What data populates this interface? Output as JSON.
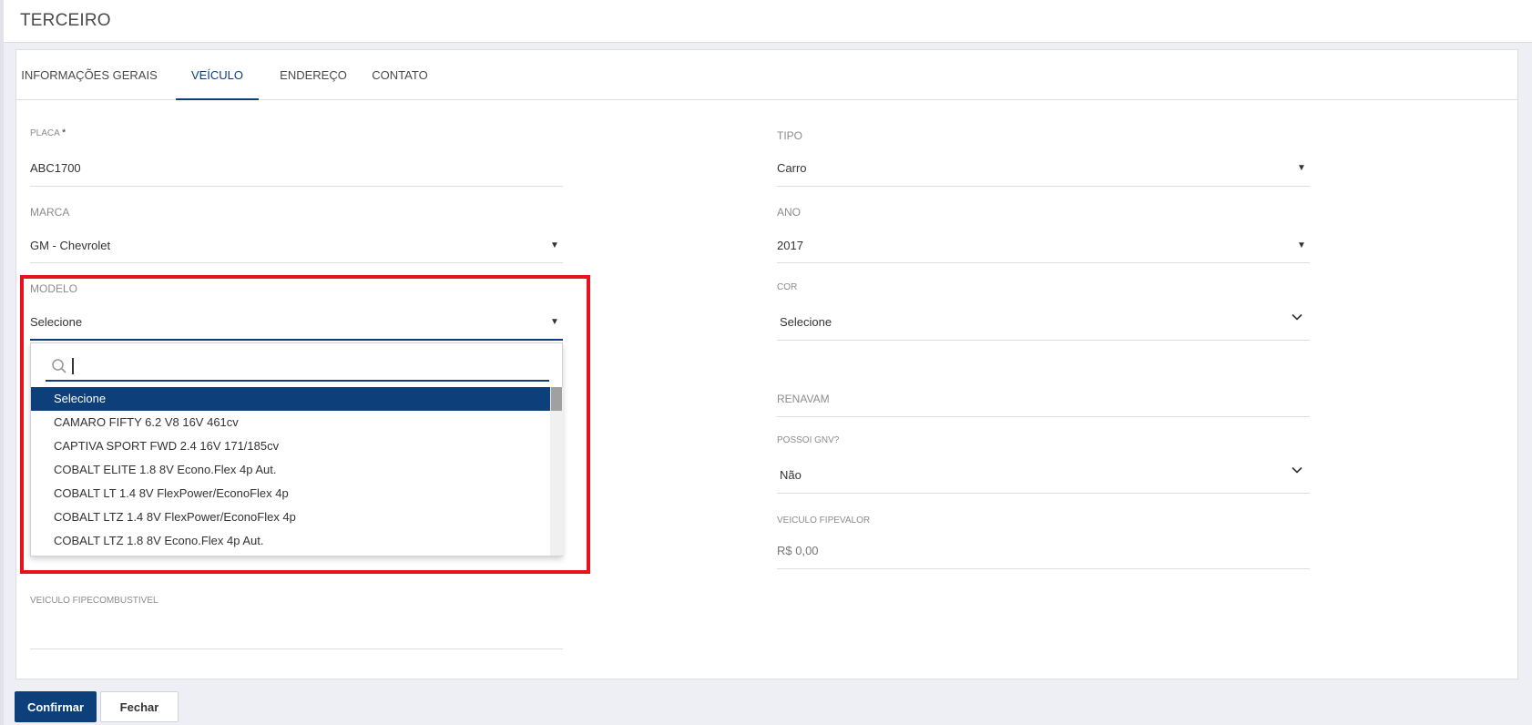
{
  "header": {
    "title": "TERCEIRO"
  },
  "tabs": [
    {
      "label": "INFORMAÇÕES GERAIS"
    },
    {
      "label": "VEÍCULO"
    },
    {
      "label": "ENDEREÇO"
    },
    {
      "label": "CONTATO"
    }
  ],
  "active_tab": "VEÍCULO",
  "fields": {
    "placa": {
      "label": "PLACA",
      "required_mark": "*",
      "value": "ABC1700"
    },
    "tipo": {
      "label": "TIPO",
      "value": "Carro"
    },
    "marca": {
      "label": "MARCA",
      "value": "GM - Chevrolet"
    },
    "ano": {
      "label": "ANO",
      "value": "2017"
    },
    "modelo": {
      "label": "MODELO",
      "value": "Selecione"
    },
    "cor": {
      "label": "COR",
      "value": "Selecione"
    },
    "renavam": {
      "label": "RENAVAM",
      "value": ""
    },
    "possui_gnv": {
      "label": "POSSOI GNV?",
      "value": "Não"
    },
    "fipe_valor": {
      "label": "VEICULO FIPEVALOR",
      "value": "R$ 0,00"
    },
    "fipe_combustivel": {
      "label": "VEICULO FIPECOMBUSTIVEL",
      "value": ""
    }
  },
  "modelo_dropdown": {
    "search_value": "",
    "options": [
      "Selecione",
      "CAMARO FIFTY 6.2 V8 16V 461cv",
      "CAPTIVA SPORT FWD 2.4 16V 171/185cv",
      "COBALT ELITE 1.8 8V Econo.Flex 4p Aut.",
      "COBALT LT 1.4 8V FlexPower/EconoFlex 4p",
      "COBALT LTZ 1.4 8V FlexPower/EconoFlex 4p",
      "COBALT LTZ 1.8 8V Econo.Flex 4p Aut."
    ],
    "selected_index": 0
  },
  "footer": {
    "confirm_label": "Confirmar",
    "close_label": "Fechar"
  },
  "colors": {
    "primary": "#0d3f7a",
    "highlight_box": "#e5141a",
    "background": "#eeeff5"
  },
  "icons": {
    "dropdown_caret": "caret-down-icon",
    "chevron": "chevron-down-icon",
    "search": "search-icon"
  }
}
